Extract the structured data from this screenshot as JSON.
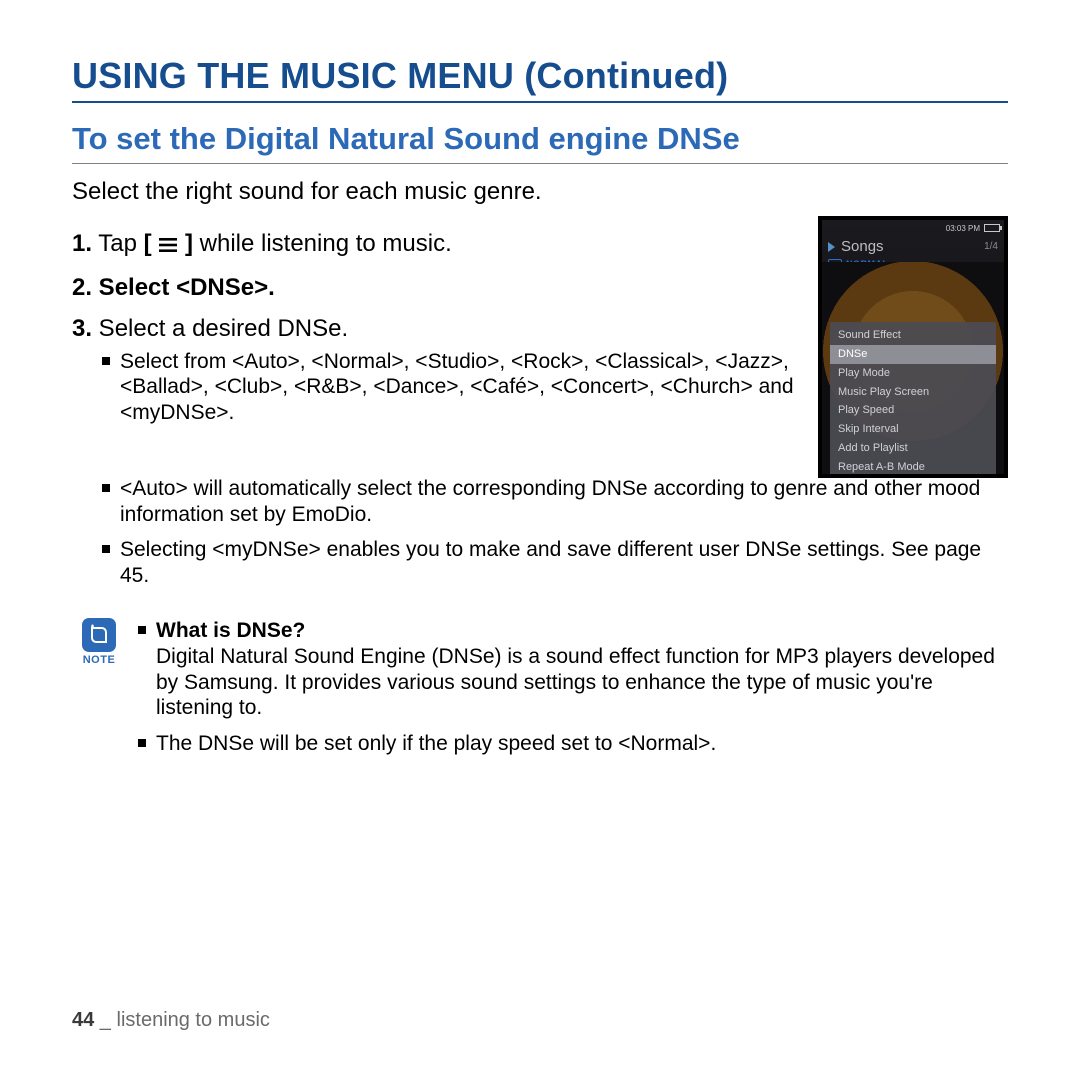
{
  "heading_main": "USING THE MUSIC MENU (Continued)",
  "heading_sub": "To set the Digital Natural Sound engine DNSe",
  "intro": "Select the right sound for each music genre.",
  "steps": {
    "s1_num": "1.",
    "s1_pre": " Tap ",
    "s1_lbracket": "[",
    "s1_rbracket": "]",
    "s1_post": " while listening to music.",
    "s2_num": "2.",
    "s2_text": " Select <DNSe>.",
    "s3_num": "3.",
    "s3_text": " Select a desired DNSe."
  },
  "bullets": {
    "b1": "Select from <Auto>, <Normal>, <Studio>, <Rock>, <Classical>, <Jazz>, <Ballad>, <Club>, <R&B>, <Dance>, <Café>, <Concert>, <Church> and <myDNSe>.",
    "b2": "<Auto> will automatically select the corresponding DNSe according to genre and other mood information set by EmoDio.",
    "b3": "Selecting <myDNSe> enables you to make and save different user DNSe settings. See page 45."
  },
  "note": {
    "label": "NOTE",
    "q": "What is DNSe?",
    "a1": "Digital Natural Sound Engine (DNSe) is a sound effect function for MP3 players developed by Samsung. It provides various sound settings to enhance the type of music you're listening to.",
    "a2": "The DNSe will be set only if the play speed set to <Normal>."
  },
  "footer": {
    "page_num": "44",
    "sep": " _ ",
    "section": "listening to music"
  },
  "device": {
    "time": "03:03 PM",
    "songs_label": "Songs",
    "count": "1/4",
    "normal_label": "NORMAL",
    "menu": [
      "Sound Effect",
      "DNSe",
      "Play Mode",
      "Music Play Screen",
      "Play Speed",
      "Skip Interval",
      "Add to Playlist",
      "Repeat A-B Mode"
    ],
    "selected_index": 1
  }
}
